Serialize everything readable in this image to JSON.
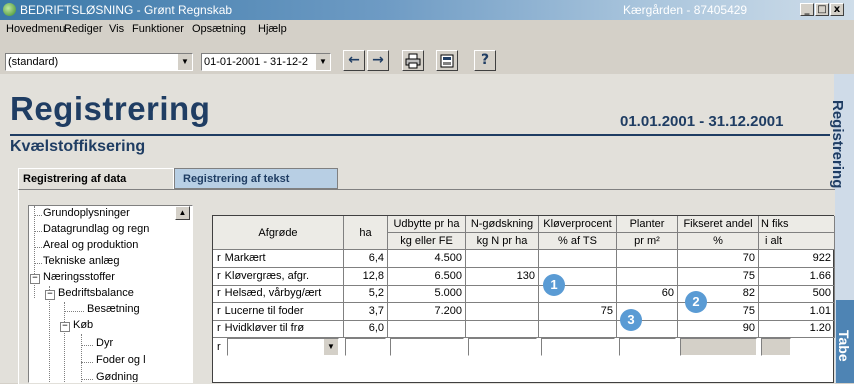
{
  "window": {
    "title": "BEDRIFTSLØSNING - Grønt Regnskab",
    "farm": "Kærgården - 87405429",
    "controls": [
      "_",
      "□",
      "x"
    ]
  },
  "menu": [
    "Hovedmenu",
    "Rediger",
    "Vis",
    "Funktioner",
    "Opsætning",
    "Hjælp"
  ],
  "toolbar": {
    "profile": "(standard)",
    "period": "01-01-2001 - 31-12-2",
    "buttons": {
      "back": "←",
      "forward": "→",
      "print": "print-icon",
      "calculator": "calculator-icon",
      "help": "?"
    }
  },
  "page": {
    "title": "Registrering",
    "period": "01.01.2001 - 31.12.2001",
    "subtitle": "Kvælstoffiksering",
    "side_label": "Registrering",
    "side_tab": "Tabe"
  },
  "tabs": [
    "Registrering af data",
    "Registrering af tekst"
  ],
  "tree": [
    {
      "label": "Grundoplysninger"
    },
    {
      "label": "Datagrundlag og regn"
    },
    {
      "label": "Areal og produktion"
    },
    {
      "label": "Tekniske anlæg"
    },
    {
      "label": "Næringsstoffer",
      "toggle": "−"
    },
    {
      "label": "Bedriftsbalance",
      "toggle": "−"
    },
    {
      "label": "Besætning"
    },
    {
      "label": "Køb",
      "toggle": "−"
    },
    {
      "label": "Dyr"
    },
    {
      "label": "Foder og l"
    },
    {
      "label": "Gødning"
    }
  ],
  "grid": {
    "headers_top": [
      "Afgrøde",
      "ha",
      "Udbytte pr ha",
      "N-gødskning",
      "Kløverprocent",
      "Planter",
      "Fikseret andel",
      "N fiks"
    ],
    "headers_sub": [
      "kg eller FE",
      "kg N pr ha",
      "% af TS",
      "pr m²",
      "%",
      "i alt"
    ],
    "rows": [
      {
        "crop": "Markært",
        "ha": "6,4",
        "udbytte": "4.500",
        "ngod": "",
        "klover": "",
        "planter": "",
        "fikseret": "70",
        "nfiks": "922"
      },
      {
        "crop": "Kløvergræs, afgr.",
        "ha": "12,8",
        "udbytte": "6.500",
        "ngod": "130",
        "klover": "",
        "planter": "",
        "fikseret": "75",
        "nfiks": "1.66"
      },
      {
        "crop": "Helsæd, vårbyg/ært",
        "ha": "5,2",
        "udbytte": "5.000",
        "ngod": "",
        "klover": "",
        "planter": "60",
        "fikseret": "82",
        "nfiks": "500"
      },
      {
        "crop": "Lucerne til foder",
        "ha": "3,7",
        "udbytte": "7.200",
        "ngod": "",
        "klover": "75",
        "planter": "",
        "fikseret": "75",
        "nfiks": "1.01"
      },
      {
        "crop": "Hvidkløver til frø",
        "ha": "6,0",
        "udbytte": "",
        "ngod": "",
        "klover": "",
        "planter": "",
        "fikseret": "90",
        "nfiks": "1.20"
      }
    ],
    "row_marker": "r",
    "badges": [
      "1",
      "2",
      "3"
    ]
  },
  "colors": {
    "heading": "#1f3d63",
    "badge": "#5a9bd4"
  }
}
